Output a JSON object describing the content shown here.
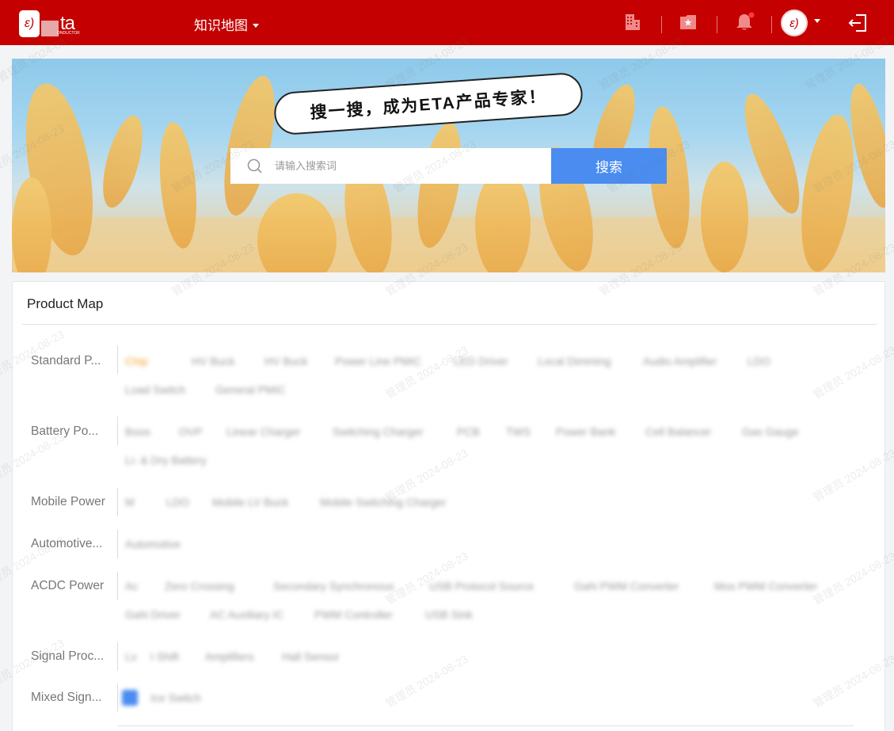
{
  "header": {
    "logo_text": "ta",
    "logo_subtext": "ONDUCTOR",
    "nav_title": "知识地图",
    "colors": {
      "bar": "#c40000",
      "accent": "#4a8cf0"
    },
    "icons": [
      "building-icon",
      "favorites-folder-icon",
      "bell-icon",
      "avatar",
      "logout-icon"
    ]
  },
  "banner": {
    "slogan": "搜一搜，成为ETA产品专家！",
    "search_placeholder": "请输入搜索词",
    "search_button": "搜索"
  },
  "product_map": {
    "title": "Product Map",
    "rows": [
      {
        "label": "Standard P...",
        "chips": [
          "Chip",
          "HV Buck",
          "HV Buck",
          "Power Line PMIC",
          "LED Driver",
          "Local Dimming",
          "Audio Amplifier",
          "LDO",
          "Load Switch",
          "General PMIC"
        ]
      },
      {
        "label": "Battery Po...",
        "chips": [
          "Boos",
          "OVP",
          "Linear Charger",
          "Switching Charger",
          "PCB",
          "TWS",
          "Power Bank",
          "Cell Balancer",
          "Gas Gauge",
          "Li- & Dry Battery"
        ]
      },
      {
        "label": "Mobile Power",
        "chips": [
          "M",
          "LDO",
          "Mobile LV Buck",
          "Mobile Switching Charger"
        ]
      },
      {
        "label": "Automotive...",
        "chips": [
          "Automotive"
        ]
      },
      {
        "label": "ACDC Power",
        "chips": [
          "Ac",
          "Zero Crossing",
          "Secondary Synchronous",
          "USB Protocol Source",
          "GaN PWM Converter",
          "Mos PWM Converter",
          "GaN Driver",
          "AC Auxiliary IC",
          "PWM Controller",
          "USB Sink"
        ]
      },
      {
        "label": "Signal Proc...",
        "chips": [
          "Lv",
          "I Shift",
          "Amplifiers",
          "Hall Sensor"
        ]
      },
      {
        "label": "Mixed Sign...",
        "chips": [
          "",
          "Ice Switch"
        ]
      }
    ]
  },
  "watermark": "管理员 2024-08-23"
}
